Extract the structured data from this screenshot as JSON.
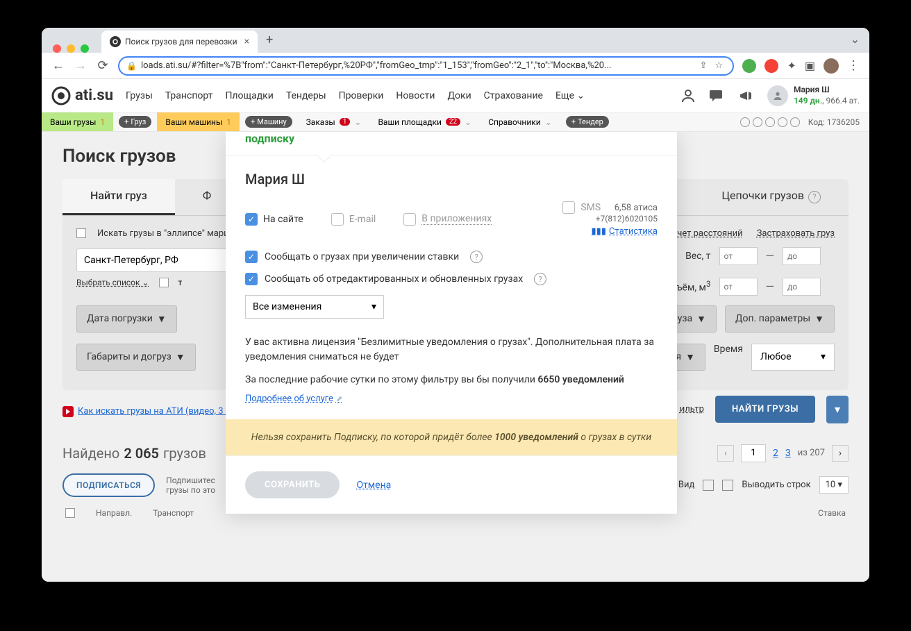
{
  "browser": {
    "tab_title": "Поиск грузов для перевозки",
    "url": "loads.ati.su/#?filter=%7B\"from\":\"Санкт-Петербург,%20РФ\",\"fromGeo_tmp\":\"1_153\",\"fromGeo\":\"2_1\",\"to\":\"Москва,%20..."
  },
  "header": {
    "logo": "ati.su",
    "nav": [
      "Грузы",
      "Транспорт",
      "Площадки",
      "Тендеры",
      "Проверки",
      "Новости",
      "Доки",
      "Страхование",
      "Еще"
    ],
    "user_name": "Мария Ш",
    "user_days": "149 дн.",
    "user_at": "966.4 ат."
  },
  "subheader": {
    "your_cargo": "Ваши грузы",
    "your_cargo_count": "1",
    "add_cargo": "Груз",
    "your_trucks": "Ваши машины",
    "your_trucks_count": "1",
    "add_truck": "Машину",
    "orders": "Заказы",
    "orders_count": "1",
    "your_sites": "Ваши площадки",
    "your_sites_count": "22",
    "refs": "Справочники",
    "add_tender": "Тендер",
    "code": "Код: 1736205"
  },
  "page": {
    "title": "Поиск грузов",
    "tab_find": "Найти груз",
    "tab_from": "Ф",
    "tab_chains": "Цепочки грузов",
    "ellipse_label": "Искать грузы в \"эллипсе\" маршр",
    "calc_distance": "Расчет расстояний",
    "insure": "Застраховать груз",
    "location": "Санкт-Петербург, РФ",
    "choose_list": "Выбрать список",
    "weight_label": "Вес, т",
    "volume_label": "Объём, м",
    "range_from": "от",
    "range_to": "до",
    "date_btn": "Дата погрузки",
    "type_btn": "уза",
    "extra_btn": "Доп. параметры",
    "dims_btn": "Габариты и догруз",
    "payment_btn": "я",
    "time_label": "Время",
    "time_value": "Любое",
    "video_link": "Как искать грузы на АТИ (видео, 3 м",
    "filter_link": "ильтр",
    "find_btn": "НАЙТИ ГРУЗЫ",
    "found_prefix": "Найдено",
    "found_count": "2 065",
    "found_suffix": "грузов",
    "page_current": "1",
    "page_2": "2",
    "page_3": "3",
    "page_of": "из",
    "page_total": "207",
    "subscribe_btn": "ПОДПИСАТЬСЯ",
    "subscribe_hint": "Подпишитес",
    "subscribe_hint2": "грузы по это",
    "view_label": "Вид",
    "rows_label": "Выводить строк",
    "rows_value": "10",
    "col_direction": "Направл.",
    "col_transport": "Транспорт",
    "col_rate": "Ставка"
  },
  "modal": {
    "title_line2": "подписку",
    "user": "Мария Ш",
    "ch_site": "На сайте",
    "ch_email": "E-mail",
    "ch_app": "В приложениях",
    "ch_sms": "SMS",
    "sms_price": "6,58 атиса",
    "sms_phone": "+7(812)6020105",
    "stats": "Статистика",
    "opt1": "Сообщать о грузах при увеличении ставки",
    "opt2": "Сообщать об отредактированных и обновленных грузах",
    "select_value": "Все изменения",
    "info1": "У вас активна лицензия \"Безлимитные уведомления о грузах\". Дополнительная плата за уведомления сниматься не будет",
    "info2_prefix": "За последние рабочие сутки по этому фильтру вы бы получили ",
    "info2_count": "6650 уведомлений",
    "service_link": "Подробнее об услуге",
    "warning_prefix": "Нельзя сохранить Подписку, по которой придёт более ",
    "warning_count": "1000 уведомлений",
    "warning_suffix": " о грузах в сутки",
    "save": "СОХРАНИТЬ",
    "cancel": "Отмена"
  }
}
